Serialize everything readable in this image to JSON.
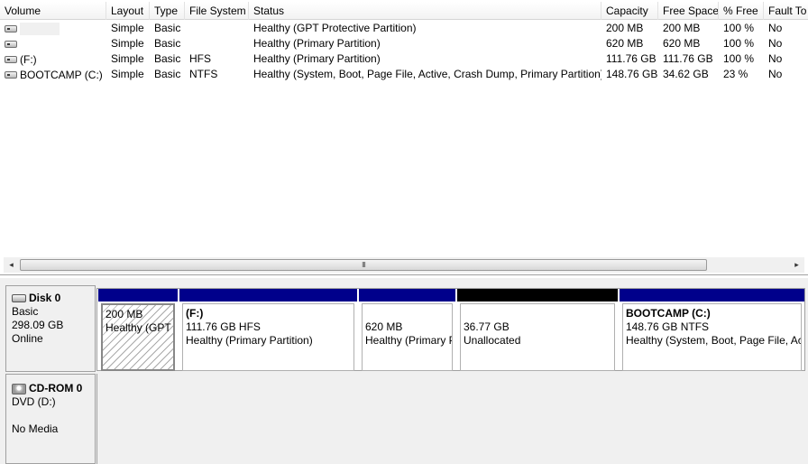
{
  "columns": [
    "Volume",
    "Layout",
    "Type",
    "File System",
    "Status",
    "Capacity",
    "Free Space",
    "% Free",
    "Fault To"
  ],
  "volumes": [
    {
      "volume": "",
      "layout": "Simple",
      "type": "Basic",
      "fs": "",
      "status": "Healthy (GPT Protective Partition)",
      "capacity": "200 MB",
      "free": "200 MB",
      "pct": "100 %",
      "fault": "No"
    },
    {
      "volume": "",
      "layout": "Simple",
      "type": "Basic",
      "fs": "",
      "status": "Healthy (Primary Partition)",
      "capacity": "620 MB",
      "free": "620 MB",
      "pct": "100 %",
      "fault": "No"
    },
    {
      "volume": "(F:)",
      "layout": "Simple",
      "type": "Basic",
      "fs": "HFS",
      "status": "Healthy (Primary Partition)",
      "capacity": "111.76 GB",
      "free": "111.76 GB",
      "pct": "100 %",
      "fault": "No"
    },
    {
      "volume": "BOOTCAMP (C:)",
      "layout": "Simple",
      "type": "Basic",
      "fs": "NTFS",
      "status": "Healthy (System, Boot, Page File, Active, Crash Dump, Primary Partition)",
      "capacity": "148.76 GB",
      "free": "34.62 GB",
      "pct": "23 %",
      "fault": "No"
    }
  ],
  "scrollbar": {
    "left_arrow": "◂",
    "right_arrow": "▸",
    "thumb_grip": "III"
  },
  "disk0": {
    "title": "Disk 0",
    "type": "Basic",
    "size": "298.09 GB",
    "status": "Online",
    "partitions": [
      {
        "name": "",
        "line1": "200 MB",
        "line2": "Healthy (GPT Protective Partition)"
      },
      {
        "name": "(F:)",
        "line1": "111.76 GB HFS",
        "line2": "Healthy (Primary Partition)"
      },
      {
        "name": "",
        "line1": "620 MB",
        "line2": "Healthy (Primary Partition)"
      },
      {
        "name": "",
        "line1": "36.77 GB",
        "line2": "Unallocated"
      },
      {
        "name": "BOOTCAMP  (C:)",
        "line1": "148.76 GB NTFS",
        "line2": "Healthy (System, Boot, Page File, Active, Crash Dump, Primary Partition)"
      }
    ]
  },
  "cdrom0": {
    "title": "CD-ROM 0",
    "drive": "DVD (D:)",
    "status": "No Media"
  },
  "colors": {
    "primary_bar": "#00008b",
    "unallocated_bar": "#000000",
    "panel_bg": "#f0f0f0"
  }
}
